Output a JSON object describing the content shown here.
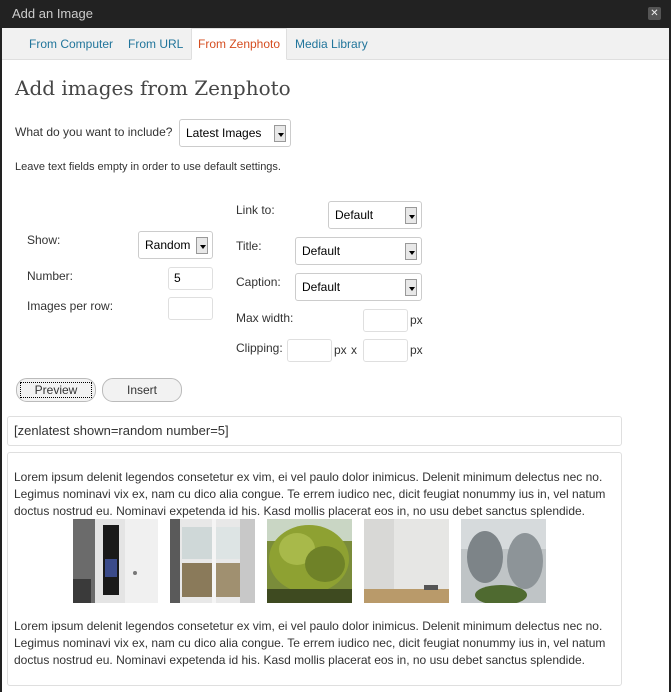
{
  "dialog": {
    "title": "Add an Image"
  },
  "tabs": [
    {
      "label": "From Computer"
    },
    {
      "label": "From URL"
    },
    {
      "label": "From Zenphoto"
    },
    {
      "label": "Media Library"
    }
  ],
  "heading": "Add images from Zenphoto",
  "include": {
    "label": "What do you want to include?",
    "value": "Latest Images"
  },
  "hint": "Leave text fields empty in order to use default settings.",
  "options": {
    "show": {
      "label": "Show:",
      "value": "Random"
    },
    "number": {
      "label": "Number:",
      "value": "5"
    },
    "per_row": {
      "label": "Images per row:",
      "value": ""
    },
    "link_to": {
      "label": "Link to:",
      "value": "Default"
    },
    "title": {
      "label": "Title:",
      "value": "Default"
    },
    "caption": {
      "label": "Caption:",
      "value": "Default"
    },
    "max_width": {
      "label": "Max width:",
      "value": "",
      "unit": "px"
    },
    "clipping": {
      "label": "Clipping:",
      "unit": "px",
      "separator": "x",
      "unit2": "px"
    }
  },
  "buttons": {
    "preview": "Preview",
    "insert": "Insert"
  },
  "shortcode": "[zenlatest shown=random number=5]",
  "preview": {
    "text_top": "Lorem ipsum delenit legendos consetetur ex vim, ei vel paulo dolor inimicus. Delenit minimum delectus nec no. Legimus nominavi vix ex, nam cu dico alia congue. Te errem iudico nec, dicit feugiat nonummy ius in, vel natum doctus nostrud eu. Nominavi expetenda id his. Kasd mollis placerat eos in, no usu debet sanctus splendide.",
    "text_bottom": "Lorem ipsum delenit legendos consetetur ex vim, ei vel paulo dolor inimicus. Delenit minimum delectus nec no. Legimus nominavi vix ex, nam cu dico alia congue. Te errem iudico nec, dicit feugiat nonummy ius in, vel natum doctus nostrud eu. Nominavi expetenda id his. Kasd mollis placerat eos in, no usu debet sanctus splendide.",
    "thumbnails": [
      "door-photo",
      "window-photo",
      "tree-photo",
      "room-corner-photo",
      "statue-photo"
    ]
  }
}
